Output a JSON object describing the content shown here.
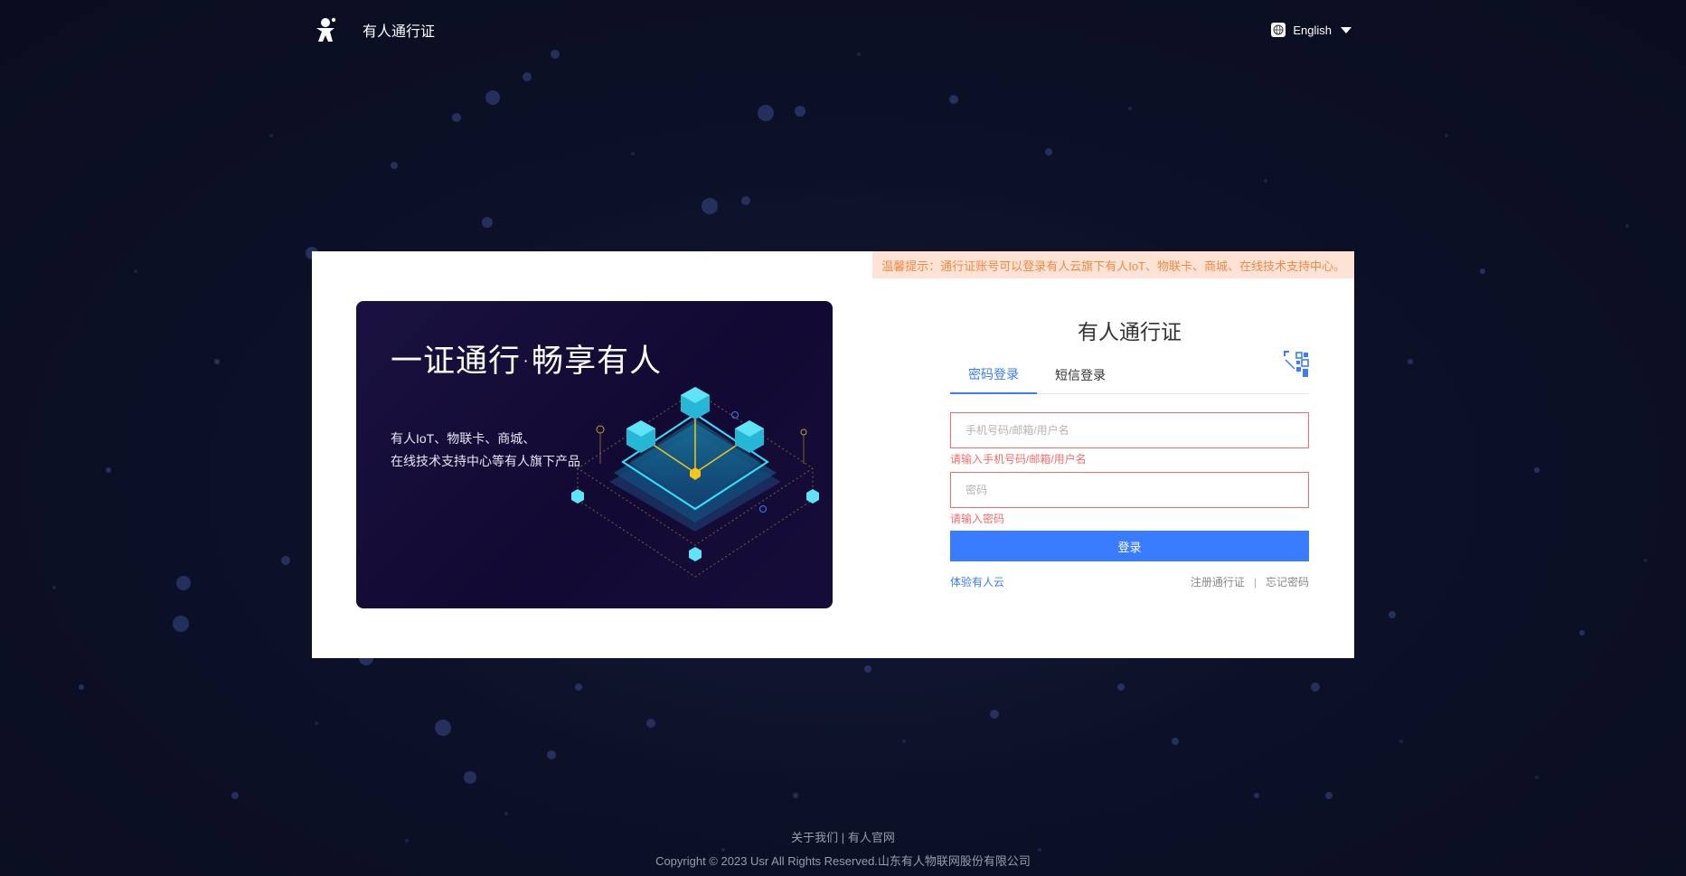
{
  "header": {
    "brand_name": "有人通行证",
    "language": "English"
  },
  "notice": "温馨提示：通行证账号可以登录有人云旗下有人IoT、物联卡、商城、在线技术支持中心。",
  "banner": {
    "title": "一证通行·畅享有人",
    "sub_line1": "有人IoT、物联卡、商城、",
    "sub_line2": "在线技术支持中心等有人旗下产品"
  },
  "login": {
    "title": "有人通行证",
    "tabs": [
      {
        "label": "密码登录",
        "active": true
      },
      {
        "label": "短信登录",
        "active": false
      }
    ],
    "account": {
      "placeholder": "手机号码/邮箱/用户名",
      "value": "",
      "error": "请输入手机号码/邮箱/用户名"
    },
    "password": {
      "placeholder": "密码",
      "value": "",
      "error": "请输入密码"
    },
    "submit_label": "登录",
    "trial_link": "体验有人云",
    "register_link": "注册通行证",
    "separator": "|",
    "forgot_link": "忘记密码"
  },
  "footer": {
    "about": "关于我们",
    "divider": "|",
    "official": "有人官网",
    "copyright": "Copyright © 2023 Usr All Rights Reserved.山东有人物联网股份有限公司"
  },
  "colors": {
    "accent": "#3a7cff",
    "error": "#f56c6c",
    "notice_bg": "#fde3d6",
    "notice_text": "#f08a45"
  }
}
